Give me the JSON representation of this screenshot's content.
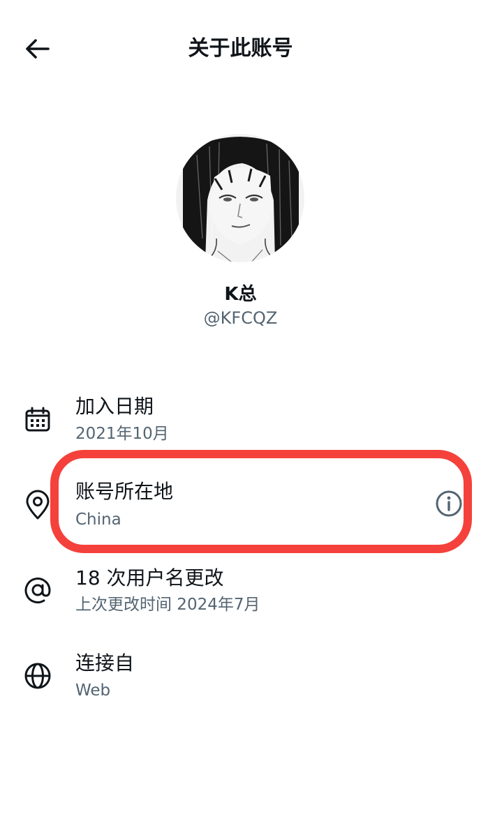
{
  "header": {
    "title": "关于此账号",
    "back_icon": "arrow-left-icon"
  },
  "profile": {
    "display_name": "K总",
    "handle": "@KFCQZ"
  },
  "rows": [
    {
      "icon": "calendar-icon",
      "title": "加入日期",
      "subtitle": "2021年10月"
    },
    {
      "icon": "location-pin-icon",
      "title": "账号所在地",
      "subtitle": "China",
      "action_icon": "info-icon"
    },
    {
      "icon": "at-sign-icon",
      "title": "18 次用户名更改",
      "subtitle": "上次更改时间 2024年7月"
    },
    {
      "icon": "globe-icon",
      "title": "连接自",
      "subtitle": "Web"
    }
  ],
  "colors": {
    "text_primary": "#0f1419",
    "text_secondary": "#536471",
    "highlight": "#f5413b"
  }
}
